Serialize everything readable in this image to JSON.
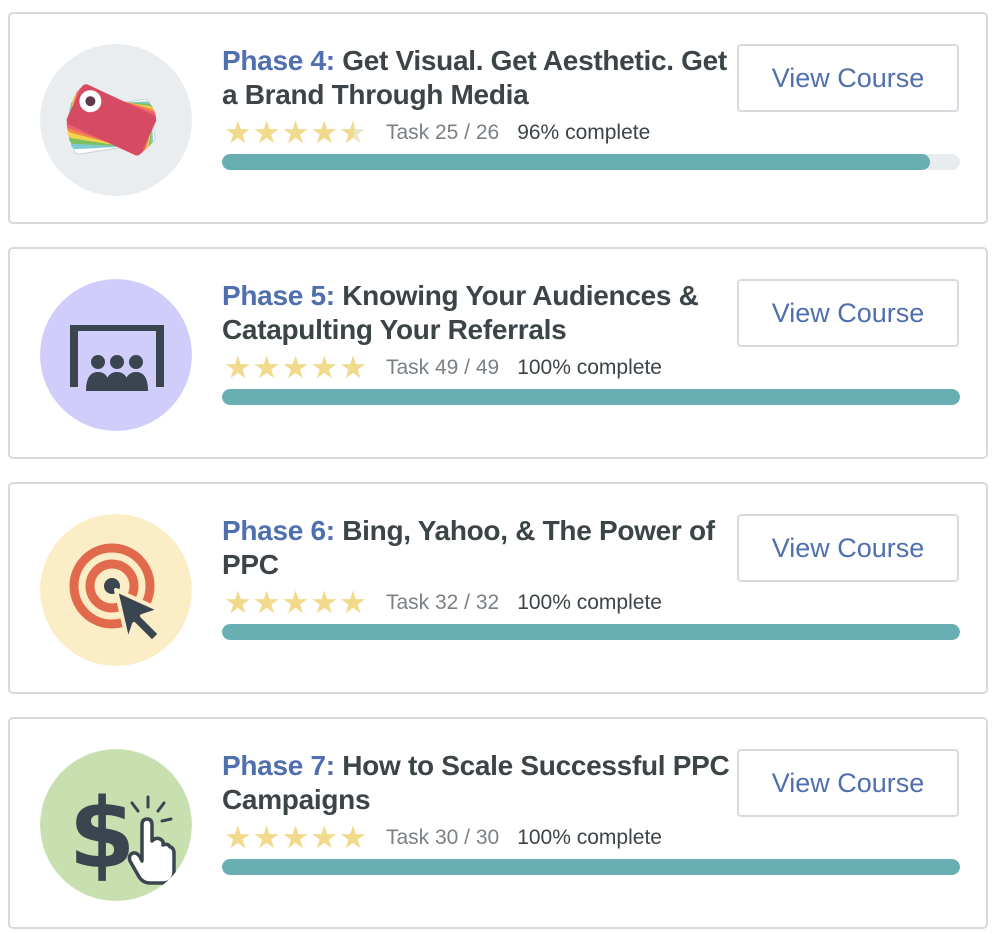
{
  "courses": [
    {
      "phase_label": "Phase 4:",
      "title": "Get Visual.  Get Aesthetic. Get a Brand Through Media",
      "rating": 4.5,
      "task_text": "Task 25 / 26",
      "complete_text": "96% complete",
      "progress_fraction": 0.96,
      "button_label": "View Course",
      "icon": "color-swatch-icon",
      "icon_bg": "#e9edf0"
    },
    {
      "phase_label": "Phase 5:",
      "title": "Knowing Your Audiences & Catapulting Your Referrals",
      "rating": 5,
      "task_text": "Task 49 / 49",
      "complete_text": "100% complete",
      "progress_fraction": 1.0,
      "button_label": "View Course",
      "icon": "audience-screen-icon",
      "icon_bg": "#d1cdfb"
    },
    {
      "phase_label": "Phase 6:",
      "title": "Bing, Yahoo, & The Power of PPC",
      "rating": 5,
      "task_text": "Task 32 / 32",
      "complete_text": "100% complete",
      "progress_fraction": 1.0,
      "button_label": "View Course",
      "icon": "target-cursor-icon",
      "icon_bg": "#fbedc6"
    },
    {
      "phase_label": "Phase 7:",
      "title": "How to Scale Successful PPC Campaigns",
      "rating": 5,
      "task_text": "Task 30 / 30",
      "complete_text": "100% complete",
      "progress_fraction": 1.0,
      "button_label": "View Course",
      "icon": "dollar-click-icon",
      "icon_bg": "#c8e0b0"
    }
  ],
  "colors": {
    "accent": "#4f6fae",
    "progress": "#68aeb3",
    "star": "#f2da8c",
    "text": "#3c4448",
    "muted": "#7a8186"
  }
}
